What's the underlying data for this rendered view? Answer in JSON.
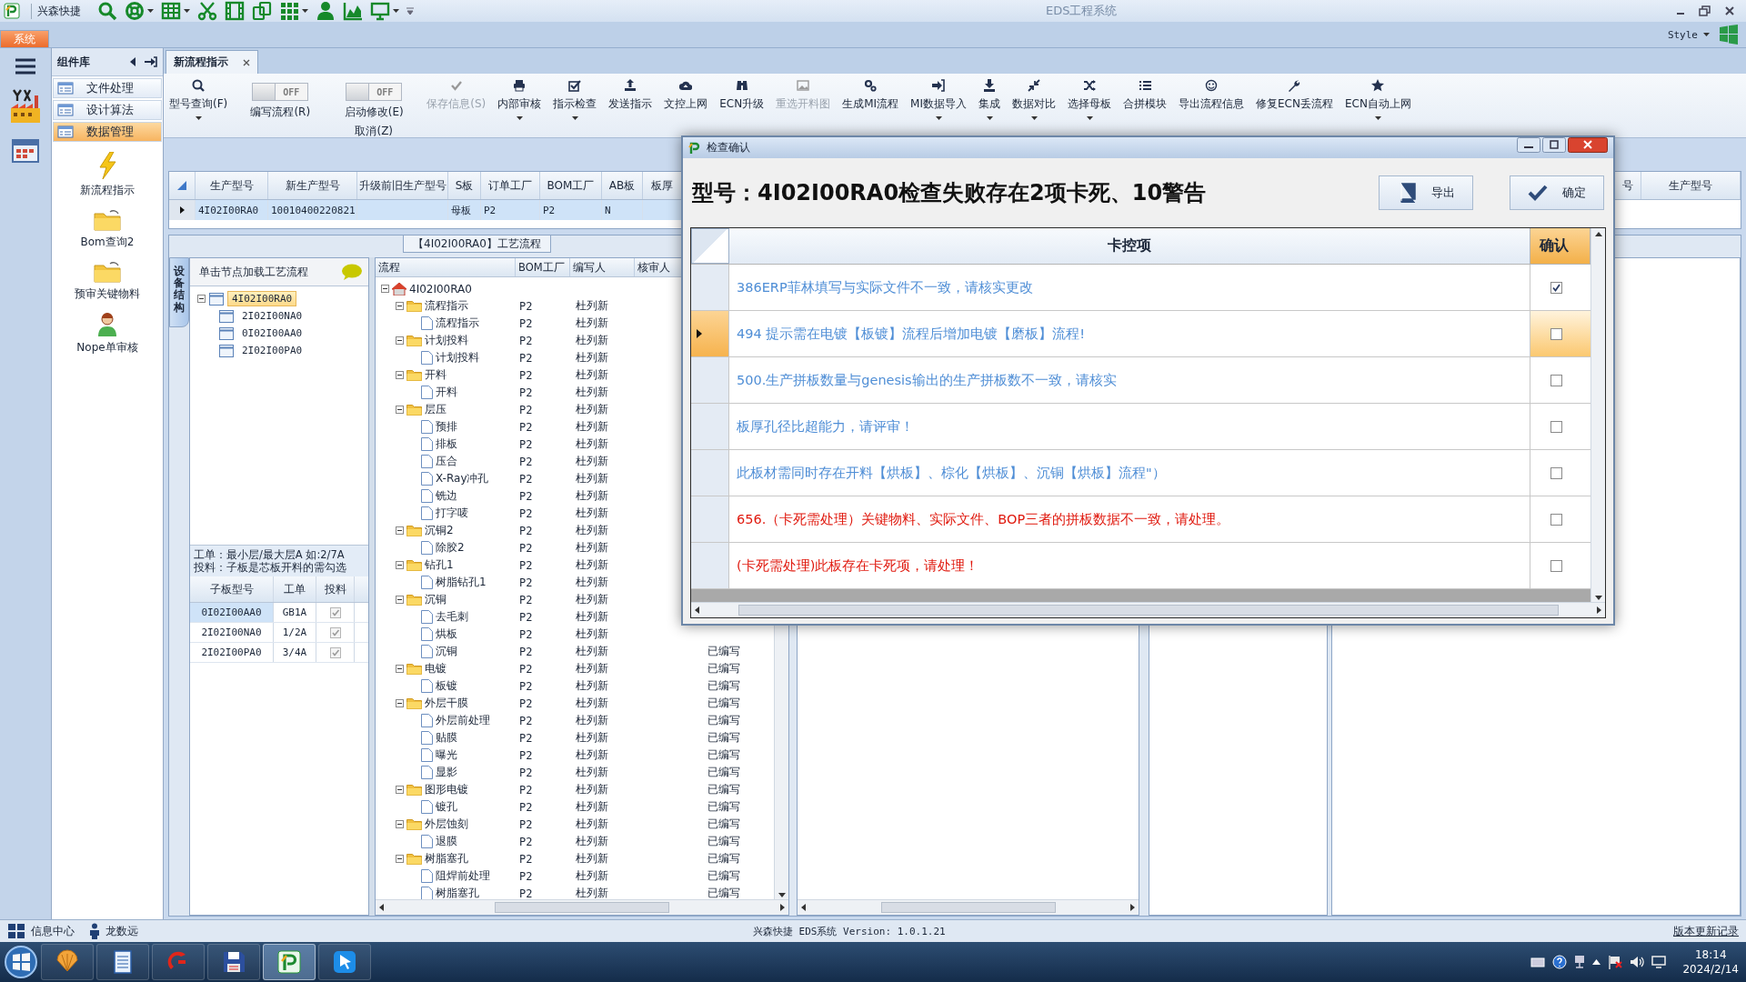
{
  "window": {
    "title": "EDS工程系统",
    "app_name": "兴森快捷"
  },
  "quick_access": [
    {
      "has_menu": false
    },
    {
      "has_menu": true
    },
    {
      "has_menu": true
    },
    {
      "has_menu": false
    },
    {
      "has_menu": false
    },
    {
      "has_menu": false
    },
    {
      "has_menu": true
    },
    {
      "has_menu": false
    },
    {
      "has_menu": false
    },
    {
      "has_menu": true
    }
  ],
  "ribbon_tabs": [
    {
      "label": "系统",
      "selected": true
    }
  ],
  "style_menu": {
    "label": "Style"
  },
  "components": {
    "title": "组件库",
    "items": [
      {
        "label": "文件处理",
        "selected": false
      },
      {
        "label": "设计算法",
        "selected": false
      },
      {
        "label": "数据管理",
        "selected": true
      }
    ],
    "tools": [
      {
        "label": "新流程指示"
      },
      {
        "label": "Bom查询2"
      },
      {
        "label": "预审关键物料"
      },
      {
        "label": "Nope单审核"
      }
    ]
  },
  "document_tabs": [
    {
      "label": "新流程指示",
      "selected": true
    }
  ],
  "toolbar": [
    {
      "kind": "button",
      "label": "型号查询(F)",
      "disabled": false,
      "has_menu": true
    },
    {
      "kind": "toggle",
      "label": "编写流程(R)",
      "switch_text": "OFF",
      "on": false
    },
    {
      "kind": "toggle",
      "label": "启动修改(E)",
      "sublabel": "取消(Z)",
      "switch_text": "OFF",
      "on": false
    },
    {
      "kind": "button",
      "label": "保存信息(S)",
      "disabled": true,
      "has_menu": false
    },
    {
      "kind": "button",
      "label": "内部审核",
      "disabled": false,
      "has_menu": true
    },
    {
      "kind": "button",
      "label": "指示检查",
      "disabled": false,
      "has_menu": true
    },
    {
      "kind": "button",
      "label": "发送指示",
      "disabled": false,
      "has_menu": false
    },
    {
      "kind": "button",
      "label": "文控上网",
      "disabled": false,
      "has_menu": false
    },
    {
      "kind": "button",
      "label": "ECN升级",
      "disabled": false,
      "has_menu": false
    },
    {
      "kind": "button",
      "label": "重选开料图",
      "disabled": true,
      "has_menu": false
    },
    {
      "kind": "button",
      "label": "生成MI流程",
      "disabled": false,
      "has_menu": false
    },
    {
      "kind": "button",
      "label": "MI数据导入",
      "disabled": false,
      "has_menu": true
    },
    {
      "kind": "button",
      "label": "集成",
      "disabled": false,
      "has_menu": true
    },
    {
      "kind": "button",
      "label": "数据对比",
      "disabled": false,
      "has_menu": true
    },
    {
      "kind": "button",
      "label": "选择母板",
      "disabled": false,
      "has_menu": true
    },
    {
      "kind": "button",
      "label": "合拼模块",
      "disabled": false,
      "has_menu": false
    },
    {
      "kind": "button",
      "label": "导出流程信息",
      "disabled": false,
      "has_menu": false
    },
    {
      "kind": "button",
      "label": "修复ECN丢流程",
      "disabled": false,
      "has_menu": false
    },
    {
      "kind": "button",
      "label": "ECN自动上网",
      "disabled": false,
      "has_menu": true
    }
  ],
  "order_grid": {
    "columns_left": [
      "生产型号",
      "新生产型号",
      "升级前旧生产型号",
      "S板",
      "订单工厂",
      "BOM工厂",
      "AB板",
      "板厚"
    ],
    "columns_right": [
      "号",
      "生产型号"
    ],
    "rows": [
      {
        "selected": true,
        "cells": [
          "4I02I00RA0",
          "10010400220821",
          null,
          "母板",
          "P2",
          "P2",
          "N",
          null
        ]
      }
    ]
  },
  "process_panel": {
    "title": "【4I02I00RA0】工艺流程",
    "side_tab": "设备结构",
    "structure": {
      "hint": "单击节点加载工艺流程",
      "tree": [
        {
          "label": "4I02I00RA0",
          "selected": true,
          "expanded": true,
          "children": [
            {
              "label": "2I02I00NA0",
              "selected": false
            },
            {
              "label": "0I02I00AA0",
              "selected": false
            },
            {
              "label": "2I02I00PA0",
              "selected": false
            }
          ]
        }
      ],
      "notes": [
        "工单：最小层/最大层A 如:2/7A",
        "投料：子板是芯板开料的需勾选"
      ],
      "board_table": {
        "columns": [
          "子板型号",
          "工单",
          "投料"
        ],
        "rows": [
          {
            "cells": [
              "0I02I00AA0",
              "GB1A"
            ],
            "feed": true,
            "selected": true
          },
          {
            "cells": [
              "2I02I00NA0",
              "1/2A"
            ],
            "feed": true,
            "selected": false
          },
          {
            "cells": [
              "2I02I00PA0",
              "3/4A"
            ],
            "feed": true,
            "selected": false
          }
        ]
      }
    },
    "process_grid": {
      "columns": [
        "流程",
        "BOM工厂",
        "编写人",
        "核审人"
      ],
      "tree": [
        {
          "label": "4I02I00RA0",
          "expanded": true,
          "children": [
            {
              "label": "流程指示",
              "bom": "P2",
              "writer": "杜列新",
              "expanded": true,
              "children": [
                {
                  "label": "流程指示",
                  "bom": "P2",
                  "writer": "杜列新"
                }
              ]
            },
            {
              "label": "计划投料",
              "bom": "P2",
              "writer": "杜列新",
              "expanded": true,
              "children": [
                {
                  "label": "计划投料",
                  "bom": "P2",
                  "writer": "杜列新"
                }
              ]
            },
            {
              "label": "开料",
              "bom": "P2",
              "writer": "杜列新",
              "expanded": true,
              "children": [
                {
                  "label": "开料",
                  "bom": "P2",
                  "writer": "杜列新"
                }
              ]
            },
            {
              "label": "层压",
              "bom": "P2",
              "writer": "杜列新",
              "expanded": true,
              "children": [
                {
                  "label": "预排",
                  "bom": "P2",
                  "writer": "杜列新"
                },
                {
                  "label": "排板",
                  "bom": "P2",
                  "writer": "杜列新"
                },
                {
                  "label": "压合",
                  "bom": "P2",
                  "writer": "杜列新"
                },
                {
                  "label": "X-Ray冲孔",
                  "bom": "P2",
                  "writer": "杜列新"
                },
                {
                  "label": "铣边",
                  "bom": "P2",
                  "writer": "杜列新"
                },
                {
                  "label": "打字唛",
                  "bom": "P2",
                  "writer": "杜列新"
                }
              ]
            },
            {
              "label": "沉铜2",
              "bom": "P2",
              "writer": "杜列新",
              "expanded": true,
              "children": [
                {
                  "label": "除胶2",
                  "bom": "P2",
                  "writer": "杜列新"
                }
              ]
            },
            {
              "label": "钻孔1",
              "bom": "P2",
              "writer": "杜列新",
              "expanded": true,
              "children": [
                {
                  "label": "树脂钻孔1",
                  "bom": "P2",
                  "writer": "杜列新"
                }
              ]
            },
            {
              "label": "沉铜",
              "bom": "P2",
              "writer": "杜列新",
              "expanded": true,
              "children": [
                {
                  "label": "去毛刺",
                  "bom": "P2",
                  "writer": "杜列新"
                },
                {
                  "label": "烘板",
                  "bom": "P2",
                  "writer": "杜列新"
                },
                {
                  "label": "沉铜",
                  "bom": "P2",
                  "writer": "杜列新",
                  "status": "已编写"
                }
              ]
            },
            {
              "label": "电镀",
              "bom": "P2",
              "writer": "杜列新",
              "status": "已编写",
              "expanded": true,
              "children": [
                {
                  "label": "板镀",
                  "bom": "P2",
                  "writer": "杜列新",
                  "status": "已编写"
                }
              ]
            },
            {
              "label": "外层干膜",
              "bom": "P2",
              "writer": "杜列新",
              "status": "已编写",
              "expanded": true,
              "children": [
                {
                  "label": "外层前处理",
                  "bom": "P2",
                  "writer": "杜列新",
                  "status": "已编写"
                },
                {
                  "label": "贴膜",
                  "bom": "P2",
                  "writer": "杜列新",
                  "status": "已编写"
                },
                {
                  "label": "曝光",
                  "bom": "P2",
                  "writer": "杜列新",
                  "status": "已编写"
                },
                {
                  "label": "显影",
                  "bom": "P2",
                  "writer": "杜列新",
                  "status": "已编写"
                }
              ]
            },
            {
              "label": "图形电镀",
              "bom": "P2",
              "writer": "杜列新",
              "status": "已编写",
              "expanded": true,
              "children": [
                {
                  "label": "镀孔",
                  "bom": "P2",
                  "writer": "杜列新",
                  "status": "已编写"
                }
              ]
            },
            {
              "label": "外层蚀刻",
              "bom": "P2",
              "writer": "杜列新",
              "status": "已编写",
              "expanded": true,
              "children": [
                {
                  "label": "退膜",
                  "bom": "P2",
                  "writer": "杜列新",
                  "status": "已编写"
                }
              ]
            },
            {
              "label": "树脂塞孔",
              "bom": "P2",
              "writer": "杜列新",
              "status": "已编写",
              "expanded": true,
              "children": [
                {
                  "label": "阻焊前处理",
                  "bom": "P2",
                  "writer": "杜列新",
                  "status": "已编写"
                },
                {
                  "label": "树脂塞孔",
                  "bom": "P2",
                  "writer": "杜列新",
                  "status": "已编写"
                }
              ]
            }
          ]
        }
      ]
    }
  },
  "dialog": {
    "title": "检查确认",
    "heading": "型号：4I02I00RA0检查失败存在2项卡死、10警告",
    "buttons": [
      {
        "label": "导出"
      },
      {
        "label": "确定"
      }
    ],
    "columns": [
      "卡控项",
      "确认"
    ],
    "rows": [
      {
        "text": "386ERP菲林填写与实际文件不一致，请核实更改",
        "color": "#4f8ed6",
        "checked": true,
        "selected": false
      },
      {
        "text": "494 提示需在电镀【板镀】流程后增加电镀【磨板】流程!",
        "color": "#4f8ed6",
        "checked": false,
        "selected": true
      },
      {
        "text": "500.生产拼板数量与genesis输出的生产拼板数不一致，请核实",
        "color": "#4f8ed6",
        "checked": false,
        "selected": false
      },
      {
        "text": "板厚孔径比超能力，请评审！",
        "color": "#4f8ed6",
        "checked": false,
        "selected": false
      },
      {
        "text": "此板材需同时存在开料【烘板】、棕化【烘板】、沉铜【烘板】流程\"）",
        "color": "#4f8ed6",
        "checked": false,
        "selected": false
      },
      {
        "text": "656.（卡死需处理）关键物料、实际文件、BOP三者的拼板数据不一致，请处理。",
        "color": "#e0190e",
        "checked": false,
        "selected": false
      },
      {
        "text": "(卡死需处理)此板存在卡死项，请处理！",
        "color": "#e0190e",
        "checked": false,
        "selected": false
      }
    ]
  },
  "status_bar": {
    "items": [
      {
        "label": "信息中心"
      },
      {
        "label": "龙数远"
      }
    ],
    "version": "兴森快捷 EDS系统 Version: 1.0.1.21",
    "link": "版本更新记录"
  },
  "taskbar": {
    "apps": [
      {
        "selected": false
      },
      {
        "selected": false
      },
      {
        "selected": false
      },
      {
        "selected": false
      },
      {
        "selected": true
      },
      {
        "selected": false
      }
    ],
    "time": "18:14",
    "date": "2024/2/14"
  }
}
